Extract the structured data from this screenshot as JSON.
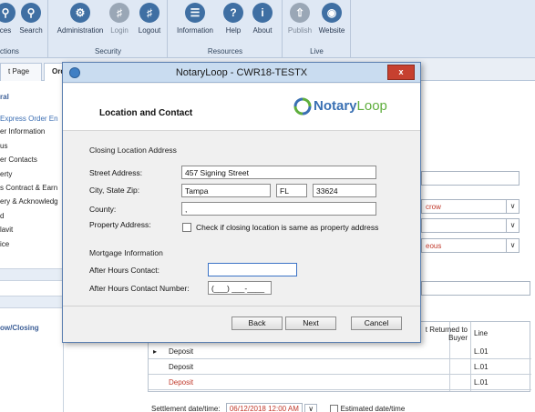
{
  "ribbon": {
    "groups": [
      {
        "title": "ctions",
        "buttons": [
          {
            "label": "ces",
            "icon": "search-icon"
          },
          {
            "label": "Search",
            "icon": "search-icon"
          }
        ]
      },
      {
        "title": "Security",
        "buttons": [
          {
            "label": "Administration",
            "icon": "gear-icon"
          },
          {
            "label": "Login",
            "icon": "key-icon"
          },
          {
            "label": "Logout",
            "icon": "key-icon"
          }
        ]
      },
      {
        "title": "Resources",
        "buttons": [
          {
            "label": "Information",
            "icon": "book-icon"
          },
          {
            "label": "Help",
            "icon": "help-icon"
          },
          {
            "label": "About",
            "icon": "info-icon"
          }
        ]
      },
      {
        "title": "Live",
        "buttons": [
          {
            "label": "Publish",
            "icon": "publish-icon"
          },
          {
            "label": "Website",
            "icon": "globe-icon"
          }
        ]
      }
    ]
  },
  "tabs": [
    {
      "label": "t Page"
    },
    {
      "label": "Ord"
    }
  ],
  "leftnav": {
    "heading1": "ral",
    "items": [
      "Express Order En",
      "er Information",
      "us",
      "er Contacts",
      "erty",
      "s Contract & Earn",
      "ery & Acknowledg",
      "d",
      "lavit",
      "ice"
    ],
    "heading2": "ow/Closing"
  },
  "background": {
    "dropdown1": "crow",
    "dropdown2": "eous",
    "grid": {
      "header_returned": "t Returned to Buyer",
      "header_line": "Line",
      "rows": [
        {
          "desc": "Deposit",
          "line": "L.01"
        },
        {
          "desc": "Deposit",
          "line": "L.01"
        },
        {
          "desc": "Deposit",
          "line": "L.01"
        }
      ]
    },
    "settlement_label": "Settlement date/time:",
    "settlement_value": "06/12/2018 12:00 AM",
    "estimated_label": "Estimated date/time"
  },
  "dialog": {
    "title": "NotaryLoop - CWR18-TESTX",
    "close_label": "x",
    "header_title": "Location and Contact",
    "logo_notary": "Notary",
    "logo_loop": "Loop",
    "section_closing": "Closing Location Address",
    "street_label": "Street Address:",
    "street_value": "457 Signing Street",
    "city_label": "City, State Zip:",
    "city_value": "Tampa",
    "state_value": "FL",
    "zip_value": "33624",
    "county_label": "County:",
    "county_value": ",",
    "property_label": "Property Address:",
    "property_checkbox_label": "Check if closing location is same as property address",
    "section_mortgage": "Mortgage Information",
    "after_hours_label": "After Hours Contact:",
    "after_hours_value": "",
    "after_hours_number_label": "After Hours Contact Number:",
    "after_hours_number_value": "(___) ___-____",
    "back_label": "Back",
    "next_label": "Next",
    "cancel_label": "Cancel"
  },
  "colors": {
    "accent": "#3a70b3",
    "logo_green": "#5fae3d",
    "close_red": "#c6402f"
  }
}
